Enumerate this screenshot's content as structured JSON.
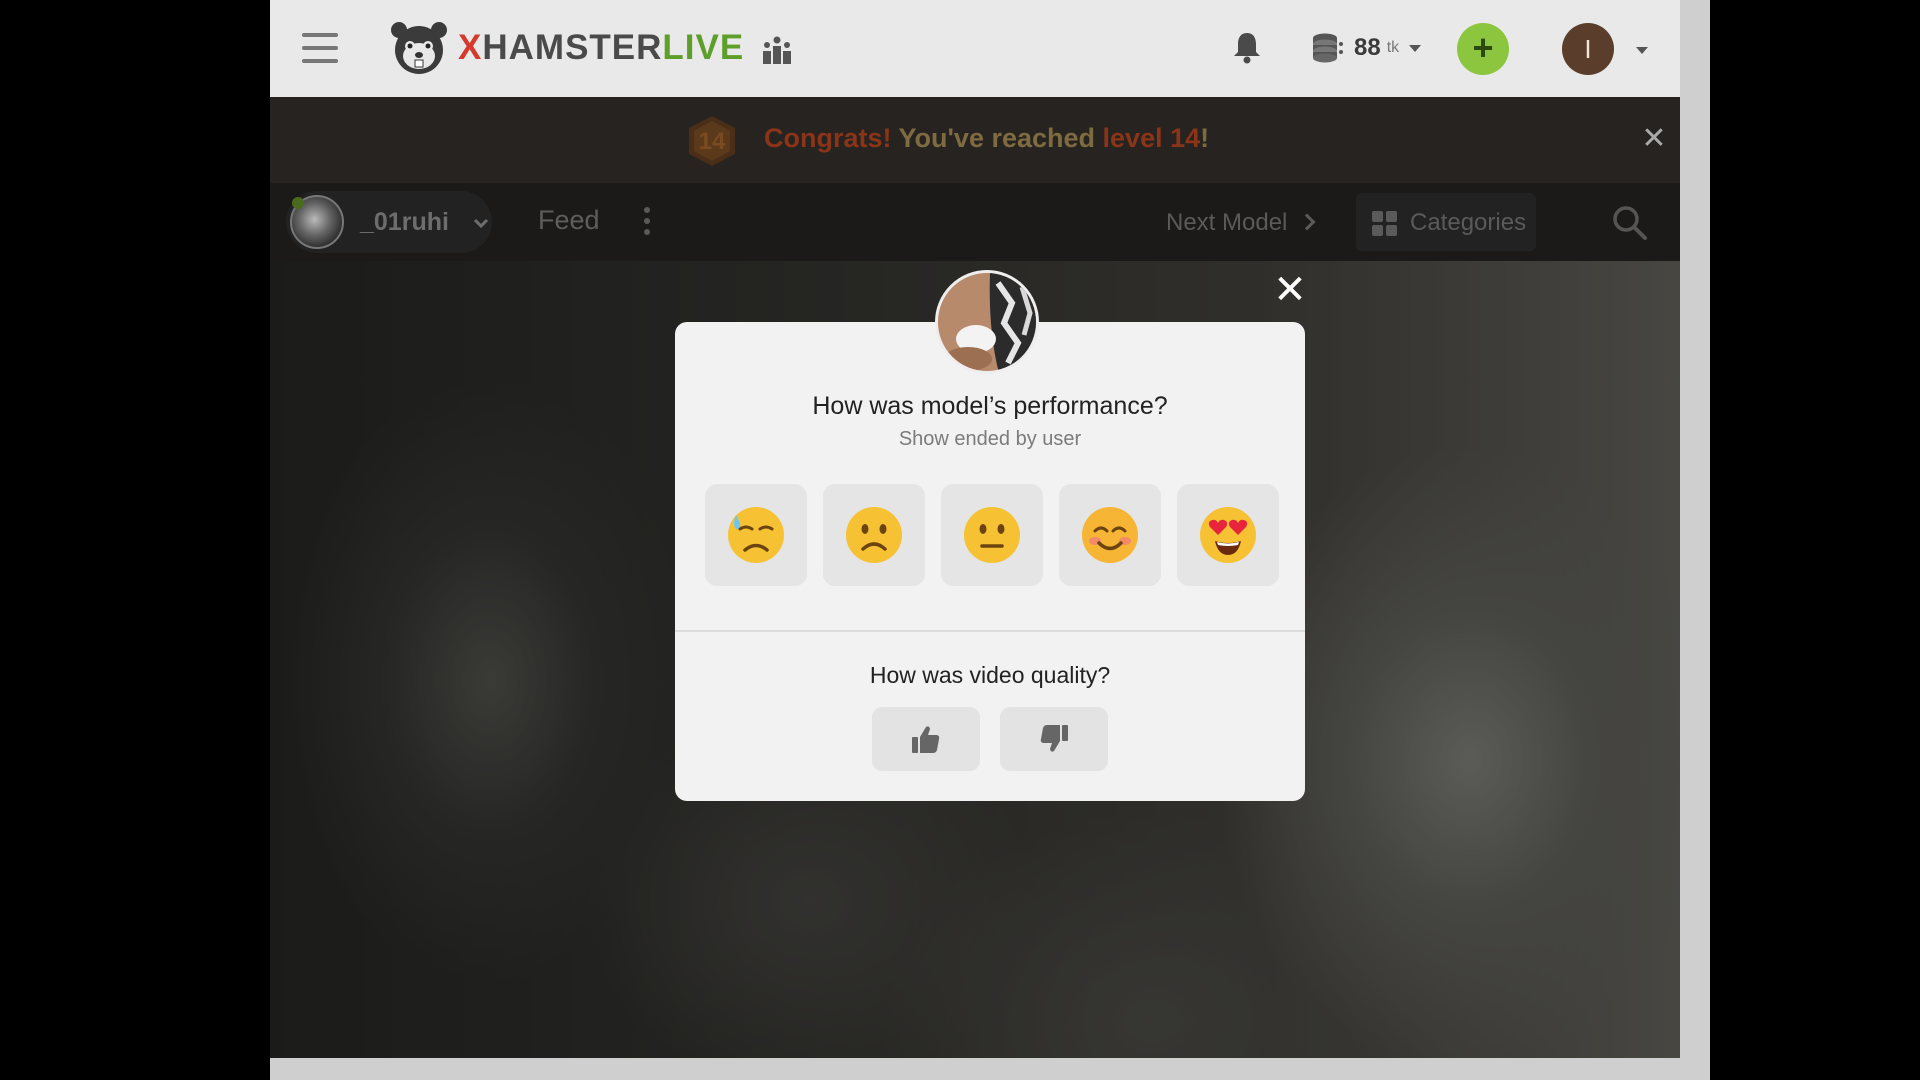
{
  "header": {
    "menu_icon": "hamburger-icon",
    "logo": {
      "x": "X",
      "hamster": "HAMSTER",
      "live": "LIVE"
    },
    "leaderboard_icon": "leaderboard-icon",
    "notifications_icon": "bell-icon",
    "tokens": {
      "amount": "88",
      "unit": "tk",
      "icon": "coins-icon"
    },
    "add_tokens_label": "+",
    "user_initial": "I",
    "colors": {
      "logo_red": "#d43b2c",
      "logo_green": "#5e9e2a",
      "add_green": "#8cc63e"
    }
  },
  "banner": {
    "level_badge": "14",
    "congrats": "Congrats!",
    "message_pre": " You've reached ",
    "level_text": "level 14",
    "message_post": "!",
    "close_label": "✕"
  },
  "model_bar": {
    "model_name": "_01ruhi",
    "feed_tab": "Feed",
    "next_model": "Next Model",
    "categories": "Categories",
    "search_icon": "search-icon"
  },
  "rating_modal": {
    "close_label": "✕",
    "performance_question": "How was model’s performance?",
    "subtitle": "Show ended by user",
    "ratings": [
      {
        "name": "rating-very-bad",
        "icon": "sad-sweat-face-icon"
      },
      {
        "name": "rating-bad",
        "icon": "slightly-frowning-face-icon"
      },
      {
        "name": "rating-neutral",
        "icon": "neutral-face-icon"
      },
      {
        "name": "rating-good",
        "icon": "smiling-face-icon"
      },
      {
        "name": "rating-great",
        "icon": "heart-eyes-face-icon"
      }
    ],
    "video_question": "How was video quality?",
    "thumbs": [
      "thumbs-up-icon",
      "thumbs-down-icon"
    ]
  }
}
